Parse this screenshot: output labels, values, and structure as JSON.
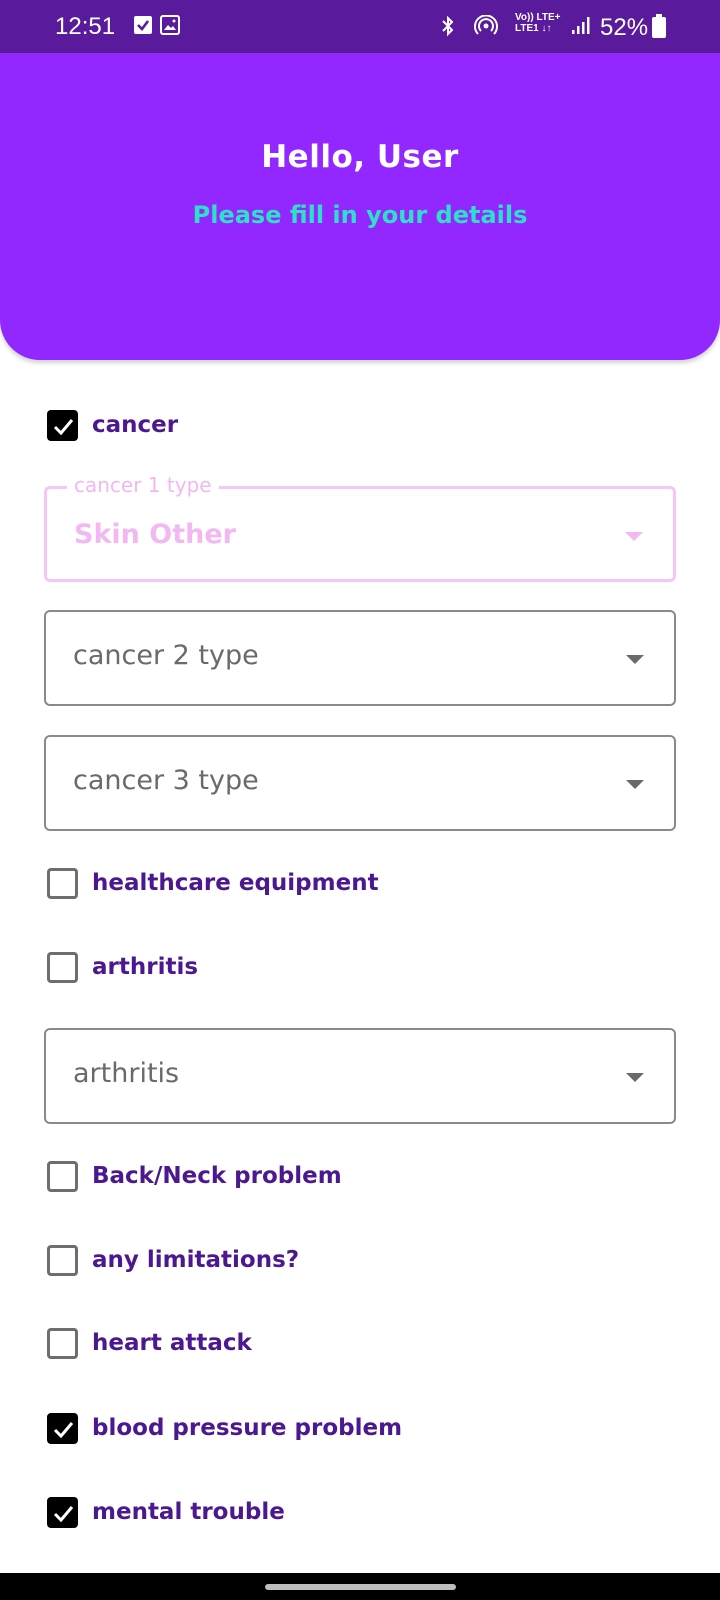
{
  "status_bar": {
    "time": "12:51",
    "network": "Vo)) LTE+\nLTE1 ↓↑",
    "battery": "52%",
    "icons": [
      "check-square-icon",
      "image-icon",
      "bluetooth-icon",
      "hotspot-icon",
      "signal-icon",
      "battery-icon"
    ]
  },
  "header": {
    "greeting": "Hello, User",
    "subtitle": "Please fill in your details",
    "background": "#9228ff",
    "subtitle_color": "#2ee0c8"
  },
  "form": {
    "cancer": {
      "label": "cancer",
      "checked": true
    },
    "cancer1": {
      "label": "cancer 1 type",
      "value": "Skin Other"
    },
    "cancer2": {
      "placeholder": "cancer 2 type"
    },
    "cancer3": {
      "placeholder": "cancer 3 type"
    },
    "healthcare_equipment": {
      "label": "healthcare equipment",
      "checked": false
    },
    "arthritis": {
      "label": "arthritis",
      "checked": false
    },
    "arthritis_dropdown": {
      "placeholder": "arthritis"
    },
    "back_neck": {
      "label": "Back/Neck problem",
      "checked": false
    },
    "limitations": {
      "label": "any limitations?",
      "checked": false
    },
    "heart_attack": {
      "label": "heart attack",
      "checked": false
    },
    "blood_pressure": {
      "label": "blood pressure problem",
      "checked": true
    },
    "mental_trouble": {
      "label": "mental trouble",
      "checked": true
    }
  },
  "colors": {
    "label": "#4b1890",
    "status_bar": "#5a1a9c",
    "focused_dropdown": "#f1b8f1"
  }
}
